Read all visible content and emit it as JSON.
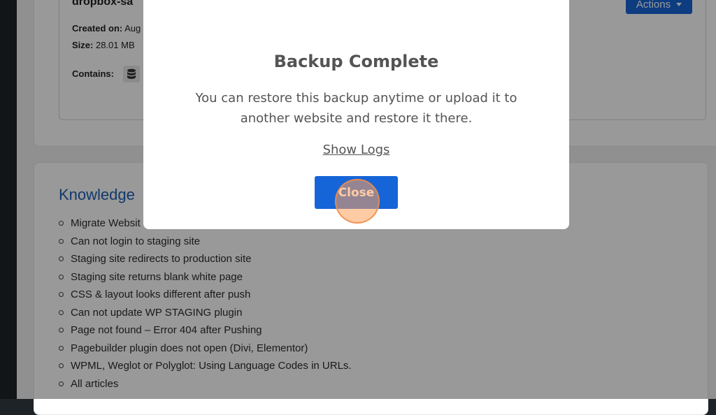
{
  "backup": {
    "name": "dropbox-sa",
    "created_label": "Created on:",
    "created_value": "Aug",
    "size_label": "Size:",
    "size_value": "28.01 MB",
    "contains_label": "Contains:",
    "actions_label": "Actions"
  },
  "knowledge": {
    "title": "Knowledge",
    "items": [
      "Migrate Websit",
      "Can not login to staging site",
      "Staging site redirects to production site",
      "Staging site returns blank white page",
      "CSS & layout looks different after push",
      "Can not update WP STAGING plugin",
      "Page not found – Error 404 after Pushing",
      "Pagebuilder plugin does not open (Divi, Elementor)",
      "WPML, Weglot or Polyglot: Using Language Codes in URLs.",
      "All articles"
    ]
  },
  "modal": {
    "title": "Backup Complete",
    "message": "You can restore this backup anytime or upload it to another website and restore it there.",
    "show_logs": "Show Logs",
    "close_label": "Close"
  },
  "icons": {
    "database": "database-icon",
    "success": "success-check-icon",
    "caret": "caret-down-icon"
  },
  "colors": {
    "accent": "#1665d8",
    "link": "#1e5fb4",
    "success_ring": "#c9e9c0",
    "click_indicator": "#f0a060"
  }
}
